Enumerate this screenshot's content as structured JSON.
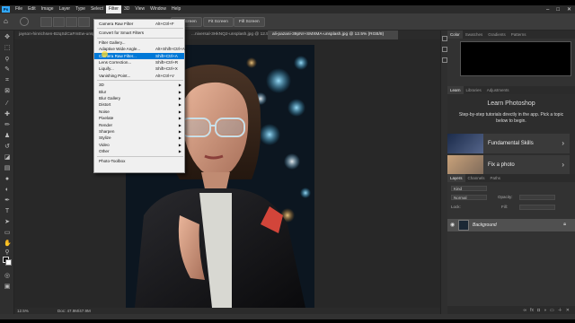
{
  "menubar": {
    "logo": "Ps",
    "items": [
      "File",
      "Edit",
      "Image",
      "Layer",
      "Type",
      "Select",
      "Filter",
      "3D",
      "View",
      "Window",
      "Help"
    ],
    "active_index": 6,
    "window_controls": [
      "–",
      "□",
      "✕"
    ]
  },
  "optbar": {
    "screen_buttons": [
      "Fill Screen",
      "Fit Screen",
      "Fill Screen"
    ]
  },
  "tabs": [
    {
      "label": "jayson-hinrichsen-B2qSdCaFmEw-unsplash.jpg",
      "active": false
    },
    {
      "label": "...niversal-3HkNQ2-unsplash.jpg @ 12.5%",
      "active": false
    },
    {
      "label": "ali-pazani-39pNr+SMXMA-unsplash.jpg @ 12.5% (RGB/8)",
      "active": true
    }
  ],
  "filter_menu": [
    {
      "label": "Camera Raw Filter",
      "shortcut": "Alt+Ctrl+F"
    },
    {
      "sep": true
    },
    {
      "label": "Convert for Smart Filters",
      "shortcut": ""
    },
    {
      "sep": true
    },
    {
      "label": "Filter Gallery...",
      "shortcut": ""
    },
    {
      "label": "Adaptive Wide Angle...",
      "shortcut": "Alt+Shift+Ctrl+A"
    },
    {
      "label": "Camera Raw Filter...",
      "shortcut": "Shift+Ctrl+A",
      "highlight": true
    },
    {
      "label": "Lens Correction...",
      "shortcut": "Shift+Ctrl+R"
    },
    {
      "label": "Liquify...",
      "shortcut": "Shift+Ctrl+X"
    },
    {
      "label": "Vanishing Point...",
      "shortcut": "Alt+Ctrl+V"
    },
    {
      "sep": true
    },
    {
      "label": "3D",
      "submenu": true
    },
    {
      "label": "Blur",
      "submenu": true
    },
    {
      "label": "Blur Gallery",
      "submenu": true
    },
    {
      "label": "Distort",
      "submenu": true
    },
    {
      "label": "Noise",
      "submenu": true
    },
    {
      "label": "Pixelate",
      "submenu": true
    },
    {
      "label": "Render",
      "submenu": true
    },
    {
      "label": "Sharpen",
      "submenu": true
    },
    {
      "label": "Stylize",
      "submenu": true
    },
    {
      "label": "Video",
      "submenu": true
    },
    {
      "label": "Other",
      "submenu": true
    },
    {
      "sep": true
    },
    {
      "label": "Photo-Toolbox",
      "shortcut": ""
    }
  ],
  "status": {
    "zoom": "12.5%",
    "doc": "Doc: 47.9M/47.9M"
  },
  "panels": {
    "color_tabs": [
      "Color",
      "Swatches",
      "Gradients",
      "Patterns"
    ],
    "learn_tabs": [
      "Learn",
      "Libraries",
      "Adjustments"
    ],
    "learn_title": "Learn Photoshop",
    "learn_subtitle": "Step-by-step tutorials directly in the app. Pick a topic below to begin.",
    "learn_cards": [
      "Fundamental Skills",
      "Fix a photo"
    ],
    "layers_tabs": [
      "Layers",
      "Channels",
      "Paths"
    ],
    "layer_filter_label": "Kind",
    "layer_blend": "Normal",
    "layer_opacity_label": "Opacity:",
    "layer_lock_label": "Lock:",
    "layer_fill_label": "Fill:",
    "layer_name": "Background"
  }
}
